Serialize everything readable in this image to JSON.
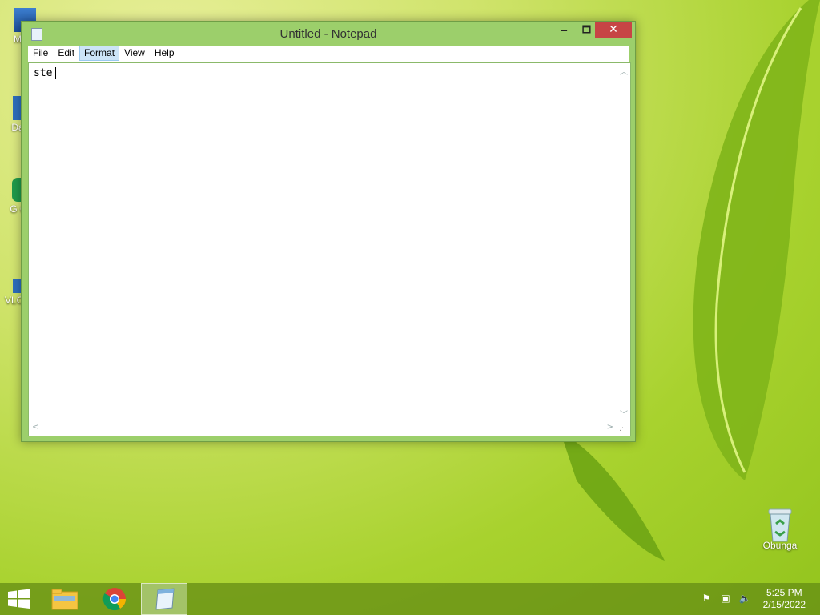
{
  "window": {
    "title": "Untitled - Notepad",
    "min_glyph": "🗕",
    "max_glyph": "🗖",
    "close_glyph": "✕"
  },
  "menu": {
    "items": [
      {
        "label": "File"
      },
      {
        "label": "Edit"
      },
      {
        "label": "Format",
        "active": true
      },
      {
        "label": "View"
      },
      {
        "label": "Help"
      }
    ]
  },
  "editor": {
    "text": "ste"
  },
  "desktop": {
    "icons": [
      {
        "label": "My C"
      },
      {
        "label": "Data"
      },
      {
        "label": "G C"
      },
      {
        "label": "VLC F"
      },
      {
        "label": "Obunga"
      }
    ]
  },
  "taskbar": {
    "apps": [
      {
        "name": "start-button"
      },
      {
        "name": "file-explorer"
      },
      {
        "name": "chrome"
      },
      {
        "name": "notepad",
        "active": true
      }
    ],
    "clock": {
      "time": "5:25 PM",
      "date": "2/15/2022"
    }
  },
  "colors": {
    "window_frame": "#9ccf6b",
    "close_button": "#c74545",
    "menu_highlight": "#cce4f7",
    "taskbar": "#648c14"
  }
}
